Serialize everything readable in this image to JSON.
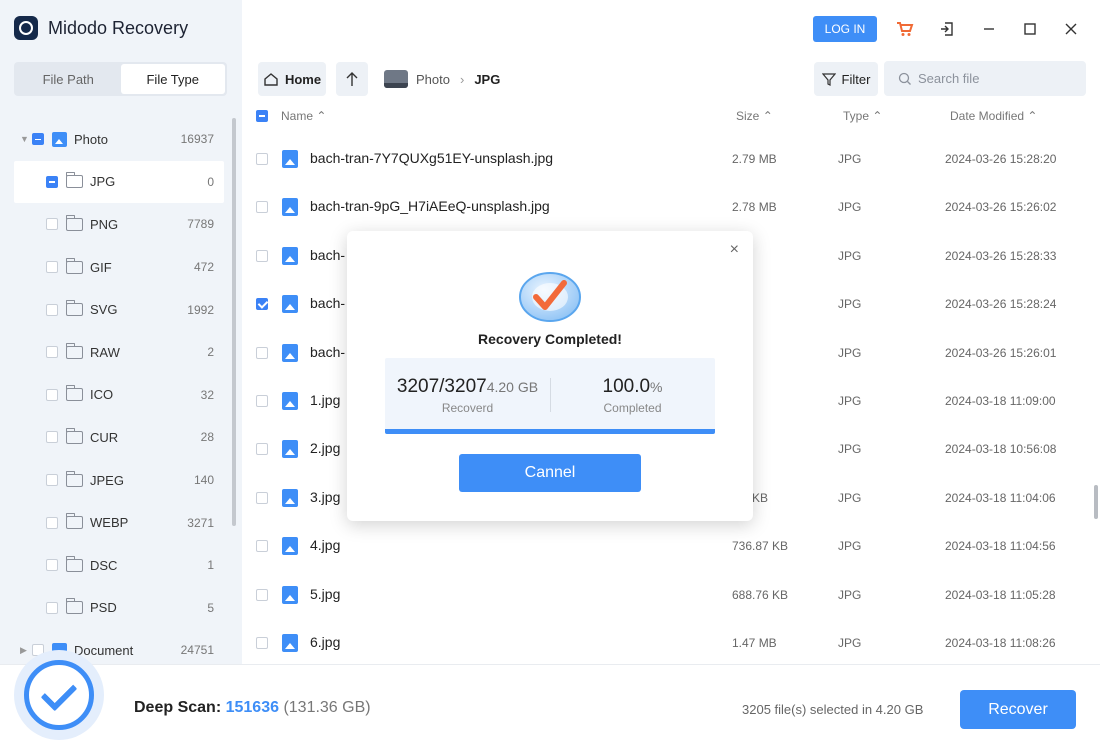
{
  "app": {
    "title": "Midodo Recovery"
  },
  "topbar": {
    "login_label": "LOG IN"
  },
  "sidebar": {
    "tabs": [
      {
        "label": "File Path",
        "active": false
      },
      {
        "label": "File Type",
        "active": true
      }
    ],
    "tree": [
      {
        "label": "Photo",
        "count": "16937",
        "level": 0,
        "expanded": true,
        "state": "partial"
      },
      {
        "label": "JPG",
        "count": "0",
        "level": 1,
        "state": "partial",
        "active": true
      },
      {
        "label": "PNG",
        "count": "7789",
        "level": 1
      },
      {
        "label": "GIF",
        "count": "472",
        "level": 1
      },
      {
        "label": "SVG",
        "count": "1992",
        "level": 1
      },
      {
        "label": "RAW",
        "count": "2",
        "level": 1
      },
      {
        "label": "ICO",
        "count": "32",
        "level": 1
      },
      {
        "label": "CUR",
        "count": "28",
        "level": 1
      },
      {
        "label": "JPEG",
        "count": "140",
        "level": 1
      },
      {
        "label": "WEBP",
        "count": "3271",
        "level": 1
      },
      {
        "label": "DSC",
        "count": "1",
        "level": 1
      },
      {
        "label": "PSD",
        "count": "5",
        "level": 1
      },
      {
        "label": "Document",
        "count": "24751",
        "level": 0,
        "expanded": false
      }
    ]
  },
  "nav": {
    "home_label": "Home",
    "breadcrumb": [
      "Photo",
      "JPG"
    ],
    "filter_label": "Filter",
    "search_placeholder": "Search file"
  },
  "table": {
    "headers": {
      "name": "Name",
      "size": "Size",
      "type": "Type",
      "date": "Date Modified"
    },
    "rows": [
      {
        "name": "bach-tran-7Y7QUXg51EY-unsplash.jpg",
        "size": "2.79 MB",
        "type": "JPG",
        "date": "2024-03-26 15:28:20",
        "checked": false
      },
      {
        "name": "bach-tran-9pG_H7iAEeQ-unsplash.jpg",
        "size": "2.78 MB",
        "type": "JPG",
        "date": "2024-03-26 15:26:02",
        "checked": false
      },
      {
        "name": "bach-",
        "size": "MB",
        "type": "JPG",
        "date": "2024-03-26 15:28:33",
        "checked": false
      },
      {
        "name": "bach-",
        "size": "MB",
        "type": "JPG",
        "date": "2024-03-26 15:28:24",
        "checked": true
      },
      {
        "name": "bach-",
        "size": "MB",
        "type": "JPG",
        "date": "2024-03-26 15:26:01",
        "checked": false
      },
      {
        "name": "1.jpg",
        "size": "MB",
        "type": "JPG",
        "date": "2024-03-18 11:09:00",
        "checked": false
      },
      {
        "name": "2.jpg",
        "size": "MB",
        "type": "JPG",
        "date": "2024-03-18 10:56:08",
        "checked": false
      },
      {
        "name": "3.jpg",
        "size": ".88 KB",
        "type": "JPG",
        "date": "2024-03-18 11:04:06",
        "checked": false
      },
      {
        "name": "4.jpg",
        "size": "736.87 KB",
        "type": "JPG",
        "date": "2024-03-18 11:04:56",
        "checked": false
      },
      {
        "name": "5.jpg",
        "size": "688.76 KB",
        "type": "JPG",
        "date": "2024-03-18 11:05:28",
        "checked": false
      },
      {
        "name": "6.jpg",
        "size": "1.47 MB",
        "type": "JPG",
        "date": "2024-03-18 11:08:26",
        "checked": false
      }
    ]
  },
  "bottom": {
    "scan_label": "Deep Scan:",
    "scan_count": "151636",
    "scan_size": "(131.36 GB)",
    "selection": "3205 file(s) selected in 4.20 GB",
    "recover_label": "Recover"
  },
  "dialog": {
    "title": "Recovery Completed!",
    "recovered_value": "3207/3207",
    "recovered_size": "4.20 GB",
    "recovered_label": "Recoverd",
    "percent_value": "100.0",
    "percent_unit": "%",
    "percent_label": "Completed",
    "progress": 1.0,
    "button_label": "Cannel"
  },
  "colors": {
    "accent": "#3e8ef7",
    "sidebar_bg": "#f0f4f9",
    "login": "#3e8ef7",
    "cart": "#f06a35"
  }
}
